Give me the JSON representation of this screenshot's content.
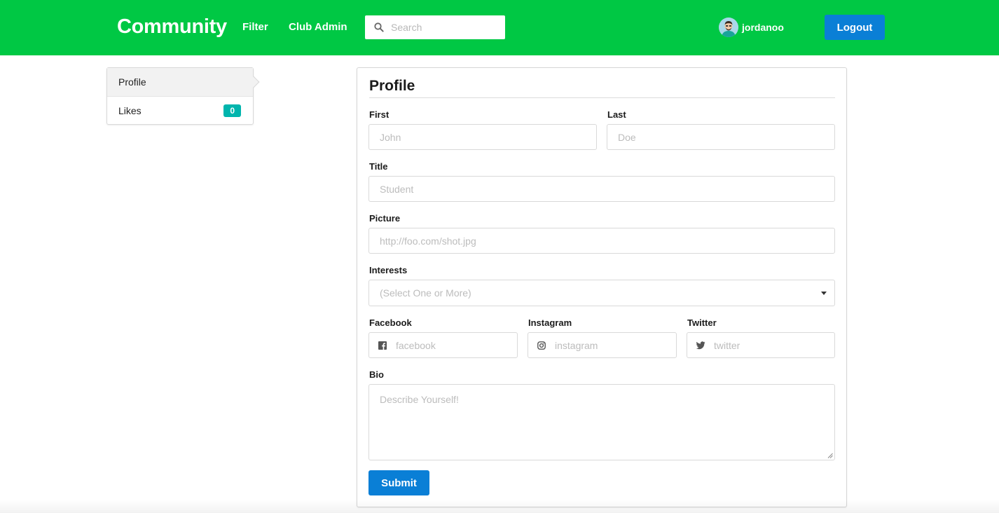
{
  "header": {
    "brand": "Community",
    "nav": [
      {
        "label": "Filter"
      },
      {
        "label": "Club Admin"
      }
    ],
    "search": {
      "placeholder": "Search",
      "value": ""
    },
    "user": {
      "name": "jordanoo"
    },
    "logout_label": "Logout"
  },
  "sidebar": {
    "items": [
      {
        "label": "Profile",
        "active": true
      },
      {
        "label": "Likes",
        "badge": "0"
      }
    ]
  },
  "form": {
    "title": "Profile",
    "first": {
      "label": "First",
      "placeholder": "John",
      "value": ""
    },
    "last": {
      "label": "Last",
      "placeholder": "Doe",
      "value": ""
    },
    "title_field": {
      "label": "Title",
      "placeholder": "Student",
      "value": ""
    },
    "picture": {
      "label": "Picture",
      "placeholder": "http://foo.com/shot.jpg",
      "value": ""
    },
    "interests": {
      "label": "Interests",
      "placeholder": "(Select One or More)"
    },
    "facebook": {
      "label": "Facebook",
      "placeholder": "facebook",
      "icon": "facebook-icon"
    },
    "instagram": {
      "label": "Instagram",
      "placeholder": "instagram",
      "icon": "instagram-icon"
    },
    "twitter": {
      "label": "Twitter",
      "placeholder": "twitter",
      "icon": "twitter-icon"
    },
    "bio": {
      "label": "Bio",
      "placeholder": "Describe Yourself!"
    },
    "submit_label": "Submit"
  },
  "colors": {
    "header_bg": "#00c844",
    "primary_button": "#0a7fd6",
    "badge": "#00b5ad"
  }
}
